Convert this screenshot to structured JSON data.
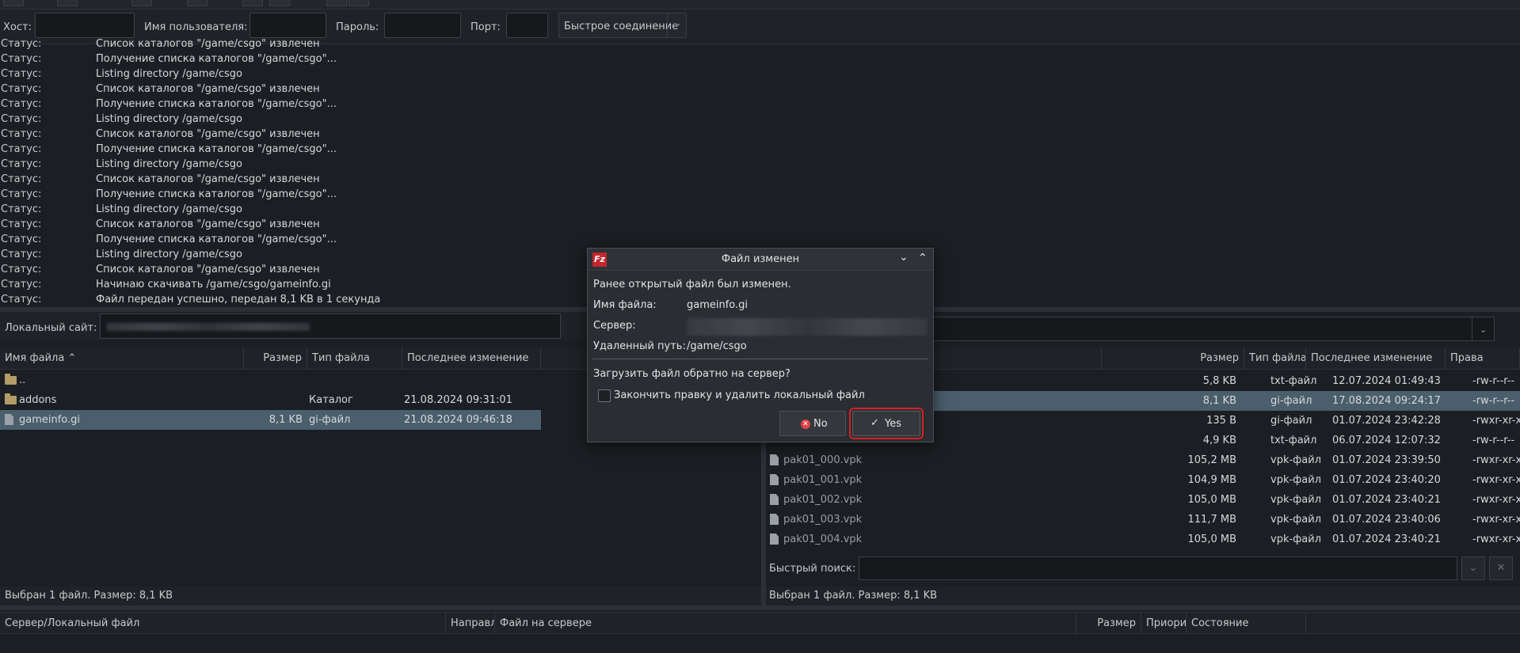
{
  "quickconnect": {
    "host_label": "Хост:",
    "user_label": "Имя пользователя:",
    "password_label": "Пароль:",
    "port_label": "Порт:",
    "connect_button": "Быстрое соединение"
  },
  "log": [
    {
      "k": "Статус:",
      "v": "Список каталогов \"/game/csgo\" извлечен"
    },
    {
      "k": "Статус:",
      "v": "Получение списка каталогов \"/game/csgo\"..."
    },
    {
      "k": "Статус:",
      "v": "Listing directory /game/csgo"
    },
    {
      "k": "Статус:",
      "v": "Список каталогов \"/game/csgo\" извлечен"
    },
    {
      "k": "Статус:",
      "v": "Получение списка каталогов \"/game/csgo\"..."
    },
    {
      "k": "Статус:",
      "v": "Listing directory /game/csgo"
    },
    {
      "k": "Статус:",
      "v": "Список каталогов \"/game/csgo\" извлечен"
    },
    {
      "k": "Статус:",
      "v": "Получение списка каталогов \"/game/csgo\"..."
    },
    {
      "k": "Статус:",
      "v": "Listing directory /game/csgo"
    },
    {
      "k": "Статус:",
      "v": "Список каталогов \"/game/csgo\" извлечен"
    },
    {
      "k": "Статус:",
      "v": "Получение списка каталогов \"/game/csgo\"..."
    },
    {
      "k": "Статус:",
      "v": "Listing directory /game/csgo"
    },
    {
      "k": "Статус:",
      "v": "Список каталогов \"/game/csgo\" извлечен"
    },
    {
      "k": "Статус:",
      "v": "Получение списка каталогов \"/game/csgo\"..."
    },
    {
      "k": "Статус:",
      "v": "Listing directory /game/csgo"
    },
    {
      "k": "Статус:",
      "v": "Список каталогов \"/game/csgo\" извлечен"
    },
    {
      "k": "Статус:",
      "v": "Начинаю скачивать /game/csgo/gameinfo.gi"
    },
    {
      "k": "Статус:",
      "v": "Файл передан успешно, передан 8,1 KB в 1 секунда"
    }
  ],
  "local": {
    "site_label": "Локальный сайт:",
    "headers": {
      "name": "Имя файла",
      "size": "Размер",
      "type": "Тип файла",
      "modified": "Последнее изменение"
    },
    "rows": [
      {
        "name": "..",
        "size": "",
        "type": "",
        "modified": "",
        "icon": "folder"
      },
      {
        "name": "addons",
        "size": "",
        "type": "Каталог",
        "modified": "21.08.2024 09:31:01",
        "icon": "folder"
      },
      {
        "name": "gameinfo.gi",
        "size": "8,1 KB",
        "type": "gi-файл",
        "modified": "21.08.2024 09:46:18",
        "icon": "file"
      }
    ],
    "status": "Выбран 1 файл. Размер: 8,1 KB"
  },
  "remote": {
    "headers": {
      "size": "Размер",
      "type": "Тип файла",
      "modified": "Последнее изменение",
      "perms": "Права"
    },
    "rows": [
      {
        "name": "",
        "size": "5,8 KB",
        "type": "txt-файл",
        "modified": "12.07.2024 01:49:43",
        "perms": "-rw-r--r--"
      },
      {
        "name": "",
        "size": "8,1 KB",
        "type": "gi-файл",
        "modified": "17.08.2024 09:24:17",
        "perms": "-rw-r--r--"
      },
      {
        "name": "",
        "size": "135 B",
        "type": "gi-файл",
        "modified": "01.07.2024 23:42:28",
        "perms": "-rwxr-xr-x"
      },
      {
        "name": "",
        "size": "4,9 KB",
        "type": "txt-файл",
        "modified": "06.07.2024 12:07:32",
        "perms": "-rw-r--r--"
      },
      {
        "name": "pak01_000.vpk",
        "size": "105,2 MB",
        "type": "vpk-файл",
        "modified": "01.07.2024 23:39:50",
        "perms": "-rwxr-xr-x"
      },
      {
        "name": "pak01_001.vpk",
        "size": "104,9 MB",
        "type": "vpk-файл",
        "modified": "01.07.2024 23:40:20",
        "perms": "-rwxr-xr-x"
      },
      {
        "name": "pak01_002.vpk",
        "size": "105,0 MB",
        "type": "vpk-файл",
        "modified": "01.07.2024 23:40:21",
        "perms": "-rwxr-xr-x"
      },
      {
        "name": "pak01_003.vpk",
        "size": "111,7 MB",
        "type": "vpk-файл",
        "modified": "01.07.2024 23:40:06",
        "perms": "-rwxr-xr-x"
      },
      {
        "name": "pak01_004.vpk",
        "size": "105,0 MB",
        "type": "vpk-файл",
        "modified": "01.07.2024 23:40:21",
        "perms": "-rwxr-xr-x"
      }
    ],
    "search_label": "Быстрый поиск:",
    "status": "Выбран 1 файл. Размер: 8,1 KB"
  },
  "queue": {
    "headers": {
      "server_local": "Сервер/Локальный файл",
      "direction": "Направл",
      "remote_file": "Файл на сервере",
      "size": "Размер",
      "priority": "Приори",
      "state": "Состояние"
    }
  },
  "dialog": {
    "title": "Файл изменен",
    "message": "Ранее открытый файл был изменен.",
    "filename_label": "Имя файла:",
    "filename": "gameinfo.gi",
    "server_label": "Сервер:",
    "remote_path_label": "Удаленный путь:",
    "remote_path": "/game/csgo",
    "question": "Загрузить файл обратно на сервер?",
    "checkbox_label": "Закончить правку и удалить локальный файл",
    "no_label": "No",
    "yes_label": "Yes",
    "logo_text": "Fz"
  }
}
